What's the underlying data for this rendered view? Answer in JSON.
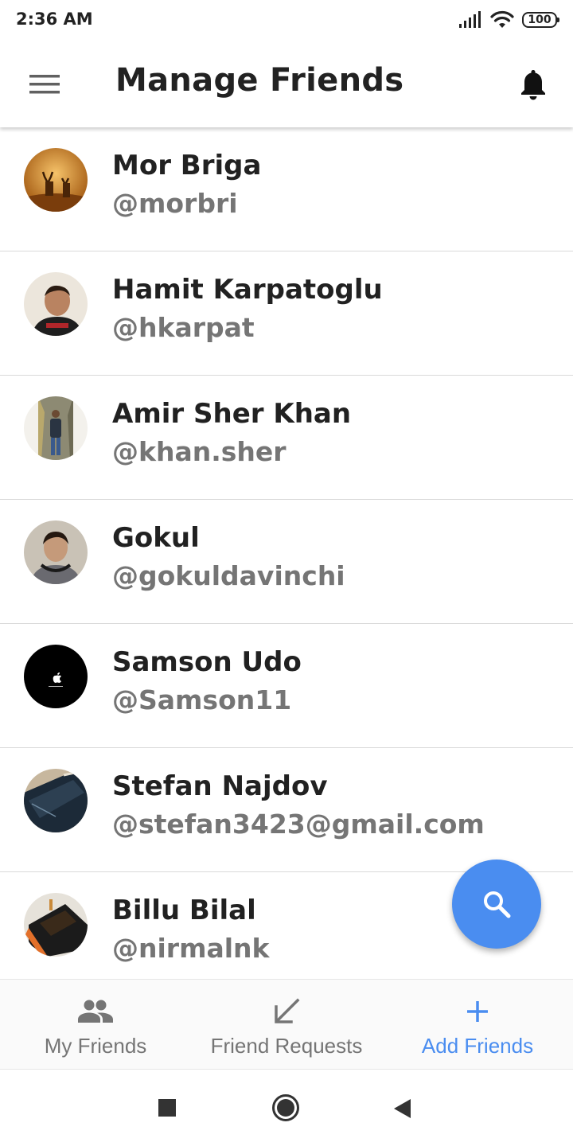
{
  "status_bar": {
    "time": "2:36 AM",
    "battery": "100"
  },
  "app_bar": {
    "title": "Manage Friends"
  },
  "friends": [
    {
      "name": "Mor Briga",
      "handle": "@morbri"
    },
    {
      "name": "Hamit Karpatoglu",
      "handle": "@hkarpat"
    },
    {
      "name": "Amir Sher Khan",
      "handle": "@khan.sher"
    },
    {
      "name": "Gokul",
      "handle": "@gokuldavinchi"
    },
    {
      "name": "Samson Udo",
      "handle": "@Samson11"
    },
    {
      "name": "Stefan Najdov",
      "handle": "@stefan3423@gmail.com"
    },
    {
      "name": "Billu Bilal",
      "handle": "@nirmalnk"
    }
  ],
  "bottom_nav": {
    "items": [
      {
        "label": "My Friends",
        "icon": "people-icon"
      },
      {
        "label": "Friend Requests",
        "icon": "arrow-down-left-icon"
      },
      {
        "label": "Add Friends",
        "icon": "plus-icon"
      }
    ]
  },
  "colors": {
    "accent": "#4a8df0",
    "text_primary": "#212121",
    "text_secondary": "#757575"
  }
}
